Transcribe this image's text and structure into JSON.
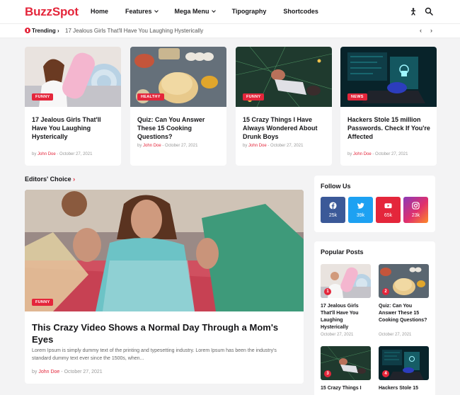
{
  "header": {
    "logo": "BuzzSpot",
    "nav": [
      {
        "label": "Home",
        "has_dropdown": false
      },
      {
        "label": "Features",
        "has_dropdown": true
      },
      {
        "label": "Mega Menu",
        "has_dropdown": true
      },
      {
        "label": "Tipography",
        "has_dropdown": false
      },
      {
        "label": "Shortcodes",
        "has_dropdown": false
      }
    ],
    "icons": [
      "dark-mode-icon",
      "search-icon"
    ]
  },
  "trending": {
    "label": "Trending",
    "headline": "17 Jealous Girls That'll Have You Laughing Hysterically",
    "prev_icon": "chevron-left-icon",
    "next_icon": "chevron-right-icon"
  },
  "cards": [
    {
      "category": "FUNNY",
      "title": "17 Jealous Girls That'll Have You Laughing Hysterically",
      "by": "by",
      "author": "John Doe",
      "date": "October 27, 2021"
    },
    {
      "category": "HEALTHY",
      "title": "Quiz: Can You Answer These 15 Cooking Questions?",
      "by": "by",
      "author": "John Doe",
      "date": "October 27, 2021"
    },
    {
      "category": "FUNNY",
      "title": "15 Crazy Things I Have Always Wondered About Drunk Boys",
      "by": "by",
      "author": "John Doe",
      "date": "October 27, 2021"
    },
    {
      "category": "NEWS",
      "title": "Hackers Stole 15 million Passwords. Check If You're Affected",
      "by": "by",
      "author": "John Doe",
      "date": "October 27, 2021"
    }
  ],
  "editors_choice": {
    "title": "Editors' Choice",
    "post": {
      "category": "FUNNY",
      "title": "This Crazy Video Shows a Normal Day Through a Mom's Eyes",
      "excerpt": "Lorem Ipsum is simply dummy text of the printing and typesetting industry. Lorem Ipsum has been the industry's standard dummy text ever since the 1500s, when...",
      "by": "by",
      "author": "John Doe",
      "date": "October 27, 2021"
    }
  },
  "follow_us": {
    "title": "Follow Us",
    "networks": [
      {
        "icon": "facebook-icon",
        "count": "25k",
        "color": "#3b5998"
      },
      {
        "icon": "twitter-icon",
        "count": "39k",
        "color": "#1da1f2"
      },
      {
        "icon": "youtube-icon",
        "count": "65k",
        "color": "#e4263b"
      },
      {
        "icon": "instagram-icon",
        "count": "23k",
        "color": "#e1306c"
      }
    ]
  },
  "popular_posts": {
    "title": "Popular Posts",
    "items": [
      {
        "rank": "1",
        "title": "17 Jealous Girls That'll Have You Laughing Hysterically",
        "date": "October 27, 2021"
      },
      {
        "rank": "2",
        "title": "Quiz: Can You Answer These 15 Cooking Questions?",
        "date": "October 27, 2021"
      },
      {
        "rank": "3",
        "title": "15 Crazy Things I",
        "date": ""
      },
      {
        "rank": "4",
        "title": "Hackers Stole 15",
        "date": ""
      }
    ]
  },
  "colors": {
    "accent": "#e4263b",
    "text": "#161619",
    "meta": "#999999",
    "background": "#f3f3f4"
  }
}
